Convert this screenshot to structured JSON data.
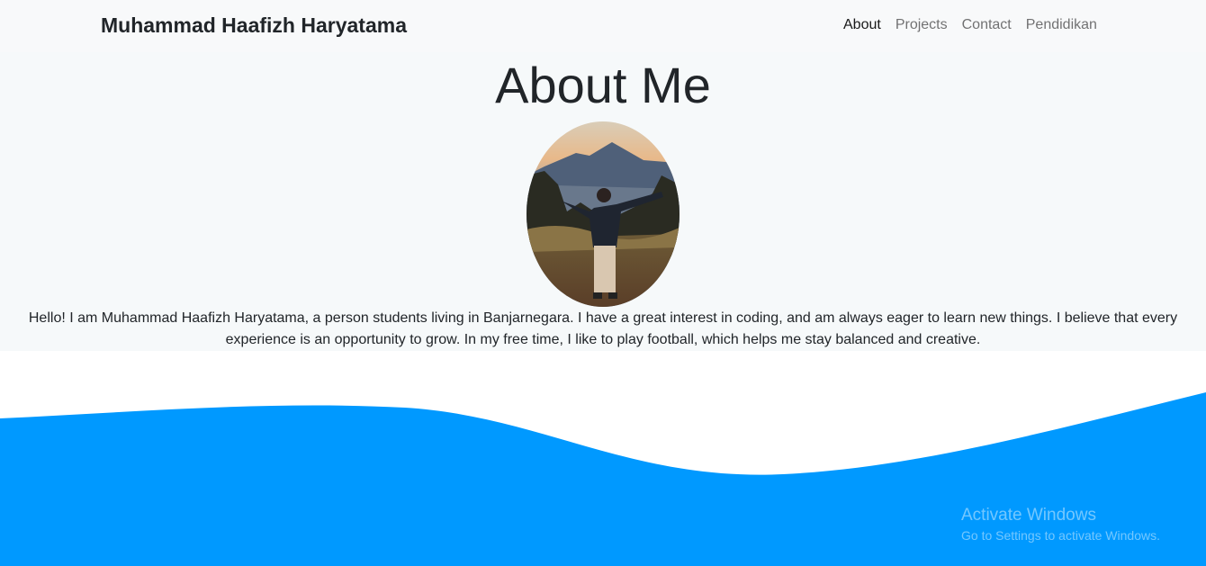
{
  "navbar": {
    "brand": "Muhammad Haafizh Haryatama",
    "links": [
      {
        "label": "About",
        "active": true
      },
      {
        "label": "Projects"
      },
      {
        "label": "Contact"
      },
      {
        "label": "Pendidikan"
      }
    ]
  },
  "about": {
    "title": "About Me",
    "bio": "Hello! I am Muhammad Haafizh Haryatama, a person students living in Banjarnegara. I have a great interest in coding, and am always eager to learn new things. I believe that every experience is an opportunity to grow. In my free time, I like to play football, which helps me stay balanced and creative."
  },
  "colors": {
    "wave": "#0099ff",
    "navbar_bg": "#f8f9fa"
  },
  "watermark": {
    "line1": "Activate Windows",
    "line2": "Go to Settings to activate Windows."
  }
}
